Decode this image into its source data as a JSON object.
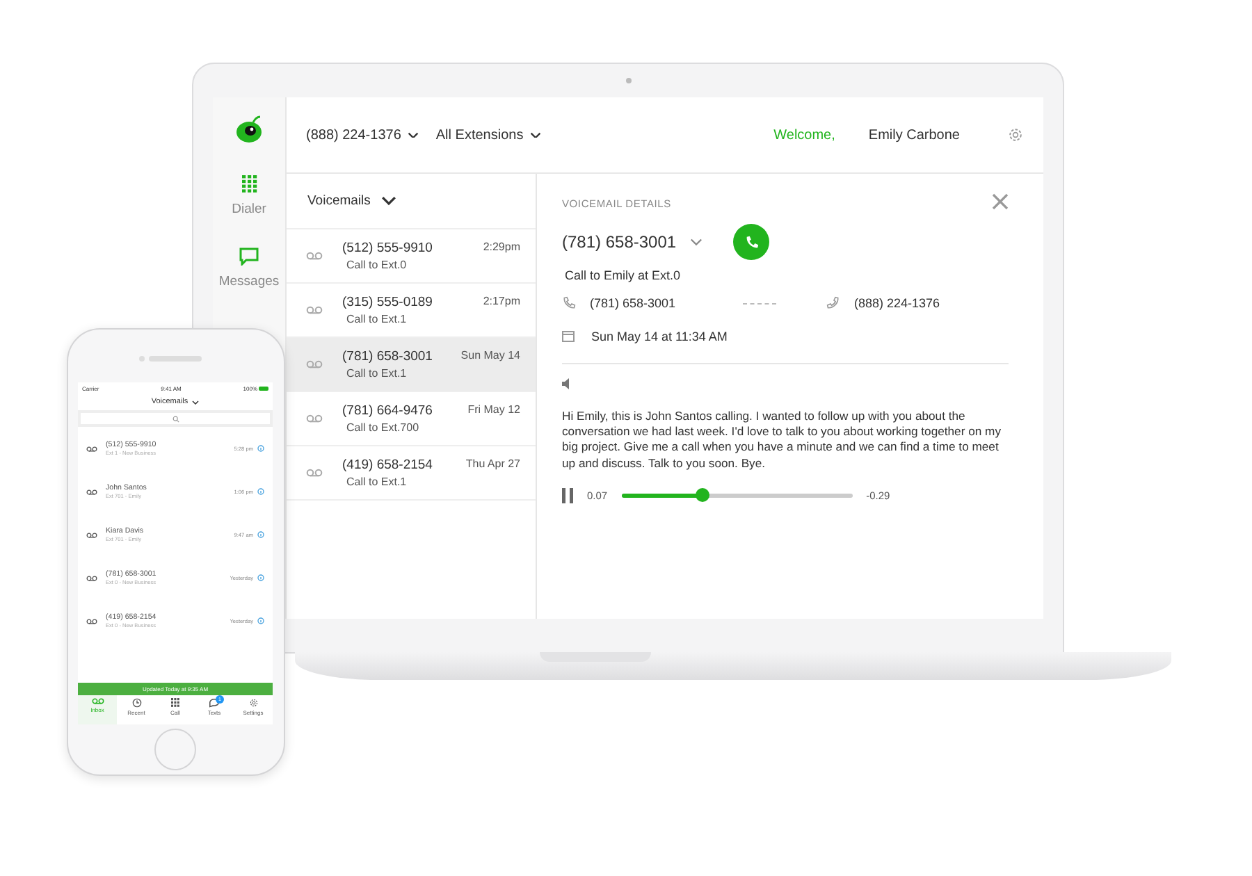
{
  "laptop": {
    "header": {
      "number": "(888) 224-1376",
      "extensions": "All Extensions",
      "welcome": "Welcome,",
      "user": "Emily Carbone"
    },
    "sidebar": [
      {
        "kind": "dialer",
        "label": "Dialer"
      },
      {
        "kind": "messages",
        "label": "Messages"
      }
    ],
    "list": {
      "title": "Voicemails",
      "rows": [
        {
          "number": "(512) 555-9910",
          "to": "Call to Ext.0",
          "time": "2:29pm",
          "selected": false
        },
        {
          "number": "(315) 555-0189",
          "to": "Call to Ext.1",
          "time": "2:17pm",
          "selected": false
        },
        {
          "number": "(781) 658-3001",
          "to": "Call to Ext.1",
          "time": "Sun May 14",
          "selected": true
        },
        {
          "number": "(781) 664-9476",
          "to": "Call to Ext.700",
          "time": "Fri May 12",
          "selected": false
        },
        {
          "number": "(419) 658-2154",
          "to": "Call to Ext.1",
          "time": "Thu Apr 27",
          "selected": false
        }
      ]
    },
    "details": {
      "title": "VOICEMAIL DETAILS",
      "number": "(781) 658-3001",
      "to": "Call to Emily at Ext.0",
      "from": "(781) 658-3001",
      "dest": "(888) 224-1376",
      "date": "Sun May 14 at 11:34 AM",
      "transcript": "Hi Emily, this is John Santos calling. I wanted to follow up with you about the conversation we had last week. I'd love to talk to you about working together on my big project. Give me a call when you have a minute and we can find a time to meet up and discuss. Talk to you soon. Bye.",
      "elapsed": "0.07",
      "remaining": "-0.29",
      "level": 0.35
    }
  },
  "phone": {
    "carrier": "Carrier",
    "clock": "9:41 AM",
    "battery": "100%",
    "title": "Voicemails",
    "rows": [
      {
        "name": "(512) 555-9910",
        "sub": "Ext 1 - New Business",
        "time": "5:28 pm"
      },
      {
        "name": "John Santos",
        "sub": "Ext 701 - Emily",
        "time": "1:06 pm"
      },
      {
        "name": "Kiara Davis",
        "sub": "Ext 701 - Emily",
        "time": "9:47 am"
      },
      {
        "name": "(781) 658-3001",
        "sub": "Ext 0 - New Business",
        "time": "Yesterday"
      },
      {
        "name": "(419) 658-2154",
        "sub": "Ext 0 - New Business",
        "time": "Yesterday"
      }
    ],
    "updated": "Updated Today at 9:35 AM",
    "tabs": [
      {
        "kind": "inbox",
        "label": "Inbox",
        "selected": true
      },
      {
        "kind": "recent",
        "label": "Recent",
        "selected": false
      },
      {
        "kind": "call",
        "label": "Call",
        "selected": false
      },
      {
        "kind": "texts",
        "label": "Texts",
        "selected": false,
        "badge": "1"
      },
      {
        "kind": "settings",
        "label": "Settings",
        "selected": false
      }
    ]
  }
}
